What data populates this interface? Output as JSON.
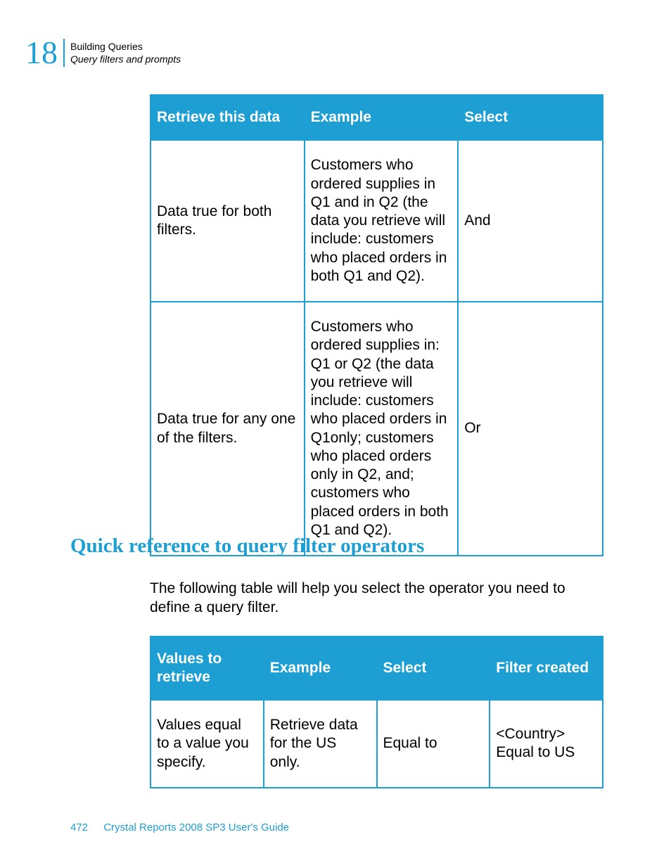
{
  "header": {
    "chapter_number": "18",
    "line1": "Building Queries",
    "line2": "Query filters and prompts"
  },
  "table1": {
    "headers": {
      "h1": "Retrieve this data",
      "h2": "Example",
      "h3": "Select"
    },
    "rows": {
      "r1": {
        "c1": "Data true for both filters.",
        "c2": "Customers who ordered supplies in Q1 and in Q2 (the data you retrieve will include: customers who placed orders in both Q1 and Q2).",
        "c3": "And"
      },
      "r2": {
        "c1": "Data true for any one of the filters.",
        "c2": "Customers who ordered supplies in: Q1 or Q2 (the data you retrieve will include: customers who placed orders in Q1only; customers who placed orders only in Q2, and; customers who placed orders in both Q1 and Q2).",
        "c3": "Or"
      }
    }
  },
  "section_heading": "Quick reference to query filter operators",
  "intro_text": "The following table will help you select the operator you need to define a query filter.",
  "table2": {
    "headers": {
      "h1": "Values to retrieve",
      "h2": "Example",
      "h3": "Select",
      "h4": "Filter created"
    },
    "rows": {
      "r1": {
        "c1": "Values equal to a value you specify.",
        "c2": "Retrieve data for the US only.",
        "c3": "Equal to",
        "c4": "<Country> Equal to US"
      }
    }
  },
  "footer": {
    "page": "472",
    "doc": "Crystal Reports 2008 SP3 User's Guide"
  }
}
